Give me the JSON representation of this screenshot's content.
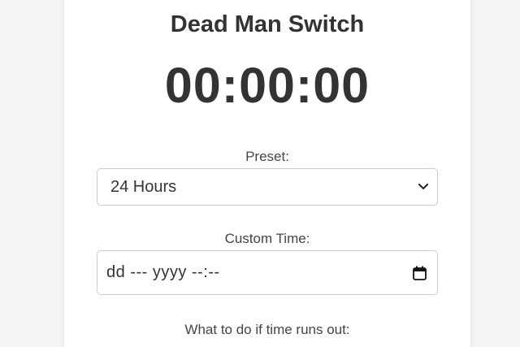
{
  "app": {
    "title": "Dead Man Switch",
    "countdown": "00:00:00"
  },
  "preset": {
    "label": "Preset:",
    "selected": "24 Hours"
  },
  "custom_time": {
    "label": "Custom Time:",
    "value": "dd --- yyyy --:--"
  },
  "action": {
    "label": "What to do if time runs out:"
  },
  "icons": {
    "select_arrow": "chevron-down-icon",
    "date_picker": "calendar-icon"
  },
  "colors": {
    "background": "#f3f4f6",
    "card": "#ffffff",
    "text": "#333333",
    "border": "#cccccc"
  }
}
